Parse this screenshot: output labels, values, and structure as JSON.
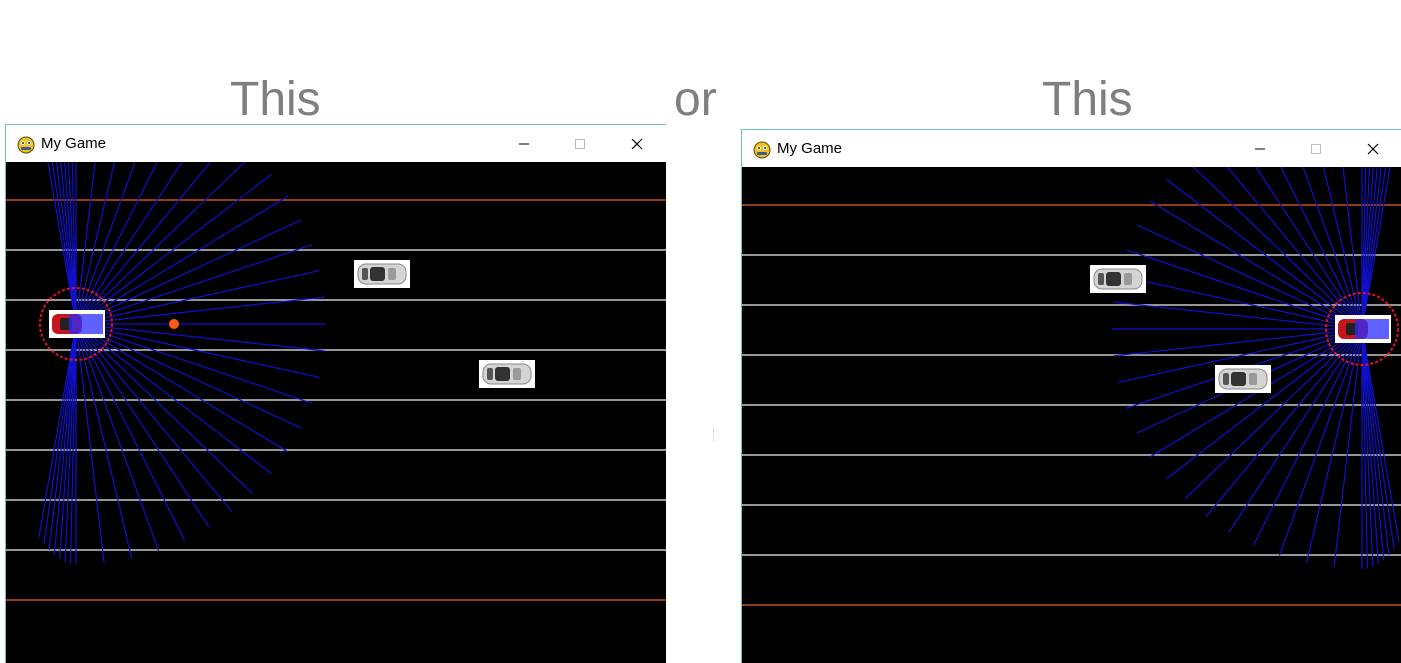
{
  "captions": {
    "left": "This",
    "middle": "or",
    "right": "This"
  },
  "windows": [
    {
      "title": "My Game",
      "buttons": {
        "minimize": "minimize",
        "maximize": "maximize",
        "close": "close"
      },
      "agent_position": "left",
      "has_target_dot": true
    },
    {
      "title": "My Game",
      "buttons": {
        "minimize": "minimize",
        "maximize": "maximize",
        "close": "close"
      },
      "agent_position": "right",
      "has_target_dot": false
    }
  ],
  "colors": {
    "road_background": "#000000",
    "border_line": "#c0531a",
    "lane_line": "#c8c8c8",
    "sensor_ray": "#1010d0",
    "sensor_circle": "#e0102a",
    "agent_car": "#c4161c",
    "traffic_car": "#d4d4d4",
    "target_dot": "#ff5a14"
  }
}
